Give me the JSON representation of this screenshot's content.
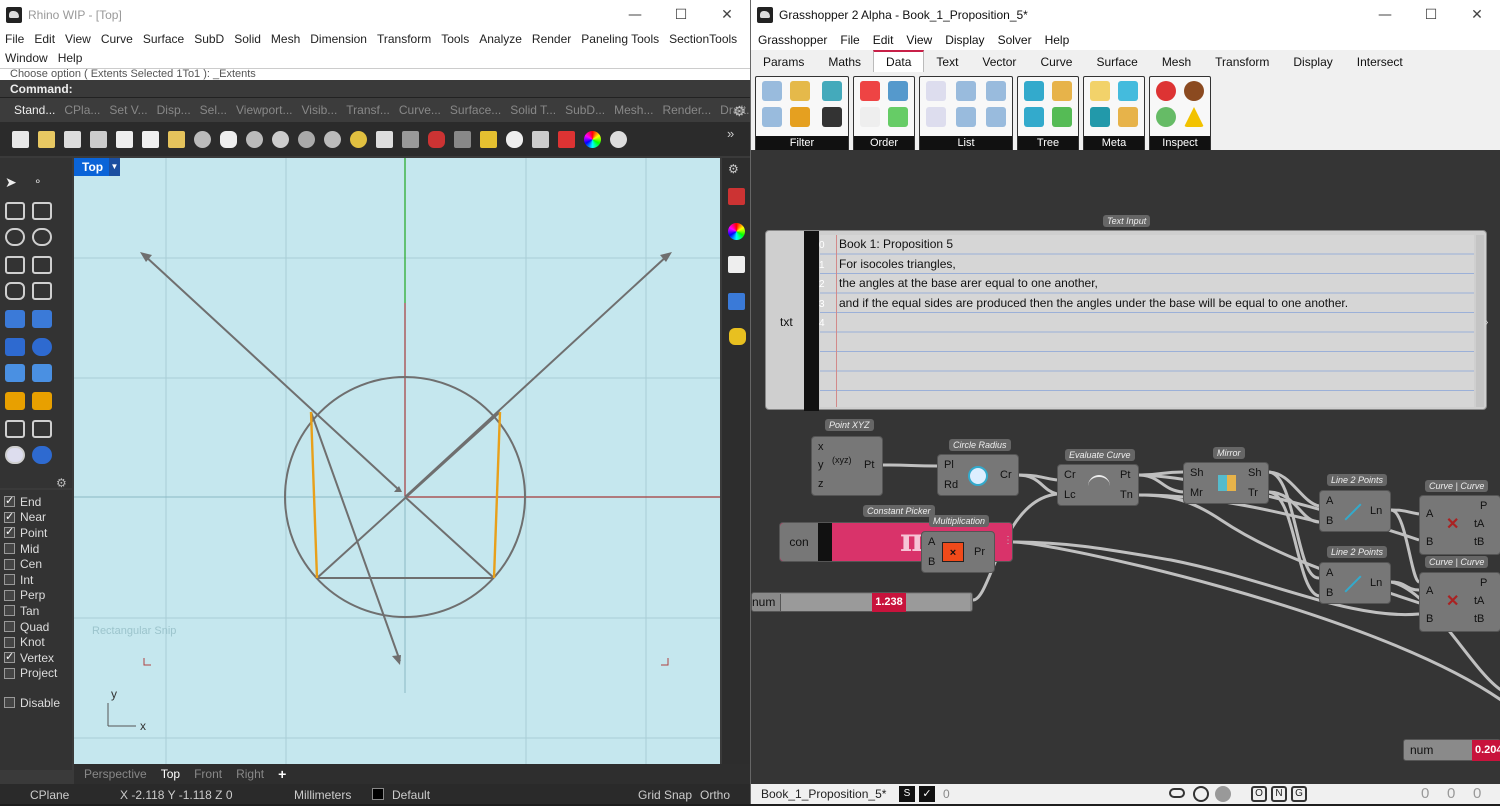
{
  "rhino": {
    "title": "Rhino WIP - [Top]",
    "menu": [
      "File",
      "Edit",
      "View",
      "Curve",
      "Surface",
      "SubD",
      "Solid",
      "Mesh",
      "Dimension",
      "Transform",
      "Tools",
      "Analyze",
      "Render",
      "Paneling Tools",
      "SectionTools",
      "Window",
      "Help"
    ],
    "command_history": "Choose option ( Extents  Selected  1To1 ): _Extents",
    "command_prompt": "Command:",
    "toolbar_tabs": [
      "Stand...",
      "CPla...",
      "Set V...",
      "Disp...",
      "Sel...",
      "Viewport...",
      "Visib...",
      "Transf...",
      "Curve...",
      "Surface...",
      "Solid T...",
      "SubD...",
      "Mesh...",
      "Render...",
      "Draft..."
    ],
    "viewport_label": "Top",
    "viewport_ghost": "Rectangular Snip",
    "axis_x": "x",
    "axis_y": "y",
    "osnaps": [
      {
        "label": "End",
        "checked": true
      },
      {
        "label": "Near",
        "checked": true
      },
      {
        "label": "Point",
        "checked": true
      },
      {
        "label": "Mid",
        "checked": false
      },
      {
        "label": "Cen",
        "checked": false
      },
      {
        "label": "Int",
        "checked": false
      },
      {
        "label": "Perp",
        "checked": false
      },
      {
        "label": "Tan",
        "checked": false
      },
      {
        "label": "Quad",
        "checked": false
      },
      {
        "label": "Knot",
        "checked": false
      },
      {
        "label": "Vertex",
        "checked": true
      },
      {
        "label": "Project",
        "checked": false
      }
    ],
    "disable_label": "Disable",
    "view_tabs": [
      "Perspective",
      "Top",
      "Front",
      "Right",
      "+"
    ],
    "status": {
      "cplane": "CPlane",
      "coords": "X -2.118  Y -1.118  Z 0",
      "units": "Millimeters",
      "layer": "Default",
      "grid_snap": "Grid Snap",
      "ortho": "Ortho"
    }
  },
  "gh": {
    "title": "Grasshopper 2 Alpha - Book_1_Proposition_5*",
    "menu": [
      "Grasshopper",
      "File",
      "Edit",
      "View",
      "Display",
      "Solver",
      "Help"
    ],
    "tabs": [
      "Params",
      "Maths",
      "Data",
      "Text",
      "Vector",
      "Curve",
      "Surface",
      "Mesh",
      "Transform",
      "Display",
      "Intersect"
    ],
    "active_tab": "Data",
    "groups": [
      "Filter",
      "Order",
      "List",
      "Tree",
      "Meta",
      "Inspect"
    ],
    "text_input": {
      "title": "Text Input",
      "param": "txt",
      "lines": [
        "Book 1: Proposition 5",
        "For isocoles triangles,",
        "the angles at the base arer equal to one another,",
        "and if the equal sides are produced then the angles under the base will be equal to one another.",
        ""
      ],
      "line_numbers": [
        "0",
        "1",
        "2",
        "3",
        "4"
      ]
    },
    "components": {
      "point_xyz": {
        "title": "Point XYZ",
        "inputs": [
          "x",
          "y",
          "z"
        ],
        "output": "Pt",
        "icon": "(xyz)"
      },
      "circle_radius": {
        "title": "Circle Radius",
        "inputs": [
          "Pl",
          "Rd"
        ],
        "output": "Cr"
      },
      "evaluate_curve": {
        "title": "Evaluate Curve",
        "inputs": [
          "Cr",
          "Lc"
        ],
        "outputs": [
          "Pt",
          "Tn"
        ]
      },
      "mirror": {
        "title": "Mirror",
        "inputs": [
          "Sh",
          "Mr"
        ],
        "outputs": [
          "Sh",
          "Tr"
        ]
      },
      "line_a": {
        "title": "Line 2 Points",
        "inputs": [
          "A",
          "B"
        ],
        "output": "Ln"
      },
      "line_b": {
        "title": "Line 2 Points",
        "inputs": [
          "A",
          "B"
        ],
        "output": "Ln"
      },
      "cc_a": {
        "title": "Curve | Curve",
        "inputs": [
          "A",
          "B"
        ],
        "outputs": [
          "P",
          "tA",
          "tB"
        ]
      },
      "cc_b": {
        "title": "Curve | Curve",
        "inputs": [
          "A",
          "B"
        ],
        "outputs": [
          "P",
          "tA",
          "tB"
        ]
      },
      "constant": {
        "title": "Constant Picker",
        "param": "con",
        "symbol": "π"
      },
      "multiplication": {
        "title": "Multiplication",
        "inputs": [
          "A",
          "B"
        ],
        "output": "Pr"
      },
      "slider1": {
        "label": "num",
        "value": "1.238"
      },
      "slider2": {
        "label": "num",
        "value": "0.204"
      }
    },
    "status": {
      "file": "Book_1_Proposition_5*",
      "count": "0",
      "right_counts": [
        "0",
        "0",
        "0"
      ]
    }
  }
}
